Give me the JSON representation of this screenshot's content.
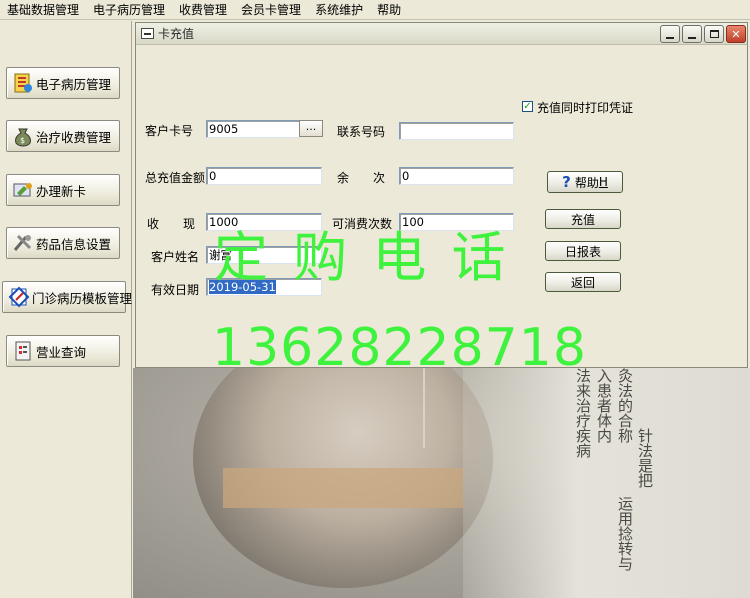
{
  "menubar": {
    "items": [
      "基础数据管理",
      "电子病历管理",
      "收费管理",
      "会员卡管理",
      "系统维护",
      "帮助"
    ]
  },
  "sidebar": {
    "items": [
      {
        "label": "电子病历管理",
        "icon": "patient-record-icon"
      },
      {
        "label": "治疗收费管理",
        "icon": "money-bag-icon"
      },
      {
        "label": "办理新卡",
        "icon": "new-card-icon"
      },
      {
        "label": "药品信息设置",
        "icon": "medicine-tools-icon"
      },
      {
        "label": "门诊病历模板管理",
        "icon": "template-icon"
      },
      {
        "label": "营业查询",
        "icon": "business-query-icon"
      }
    ]
  },
  "window": {
    "title": "卡充值",
    "print_receipt_label": "充值同时打印凭证",
    "print_receipt_checked": true,
    "card_no_label": "客户卡号",
    "card_no_value": "9005",
    "browse_label": "...",
    "phone_label": "联系号码",
    "phone_value": "",
    "total_label": "总充值金额",
    "total_value": "0",
    "remaining_label": "余　　次",
    "remaining_value": "0",
    "help_label": "帮助",
    "help_hotkey": "H",
    "cash_label": "收　　现",
    "cash_value": "1000",
    "consumable_label": "可消费次数",
    "consumable_value": "100",
    "recharge_button": "充值",
    "name_label": "客户姓名",
    "name_value": "谢富",
    "daily_report_button": "日报表",
    "expiry_label": "有效日期",
    "expiry_value": "2019-05-31",
    "return_button": "返回"
  },
  "watermark": {
    "line1": "定 购 电 话",
    "line2": "13628228718",
    "color": "#3ef23e"
  },
  "background_text": [
    "灸法的合称",
    "入患者体内",
    "法来治疗疾病",
    "针法是把",
    "运用捻转与"
  ]
}
